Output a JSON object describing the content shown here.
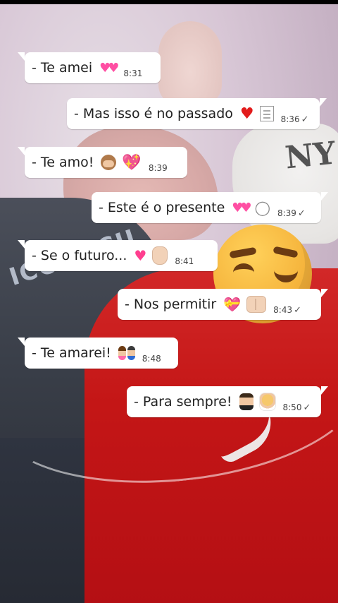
{
  "chat": {
    "messages": [
      {
        "direction": "in",
        "text": "- Te amei",
        "time": "8:31",
        "icons": [
          "two-hearts-emoji"
        ]
      },
      {
        "direction": "out",
        "text": "- Mas isso é no passado",
        "time": "8:36",
        "icons": [
          "red-heart-emoji",
          "memo-emoji"
        ],
        "status": "✓"
      },
      {
        "direction": "in",
        "text": "-  Te amo!",
        "time": "8:39",
        "icons": [
          "see-no-evil-monkey-emoji",
          "sparkling-heart-emoji"
        ]
      },
      {
        "direction": "out",
        "text": "- Este é o presente",
        "time": "8:39",
        "icons": [
          "two-hearts-emoji",
          "ring-emoji"
        ],
        "status": "✓"
      },
      {
        "direction": "in",
        "text": "-  Se o futuro...",
        "time": "8:41",
        "icons": [
          "heart-with-arrow-emoji",
          "raised-hand-emoji"
        ]
      },
      {
        "direction": "out",
        "text": "-  Nos permitir",
        "time": "8:43",
        "icons": [
          "heart-with-ribbon-emoji",
          "raising-hands-emoji"
        ],
        "status": "✓"
      },
      {
        "direction": "in",
        "text": "- Te amarei!",
        "time": "8:48",
        "icons": [
          "couple-with-heart-emoji"
        ]
      },
      {
        "direction": "out",
        "text": "- Para sempre!",
        "time": "8:50",
        "icons": [
          "groom-emoji",
          "bride-emoji"
        ],
        "status": "✓"
      }
    ]
  },
  "background": {
    "cap_logo_text": "NY",
    "shirt_print_text": "ICOBOCU",
    "sticker_icon": "winking-face-emoji"
  },
  "colors": {
    "bubble": "#ffffff",
    "text": "#222222",
    "time": "#444444"
  }
}
